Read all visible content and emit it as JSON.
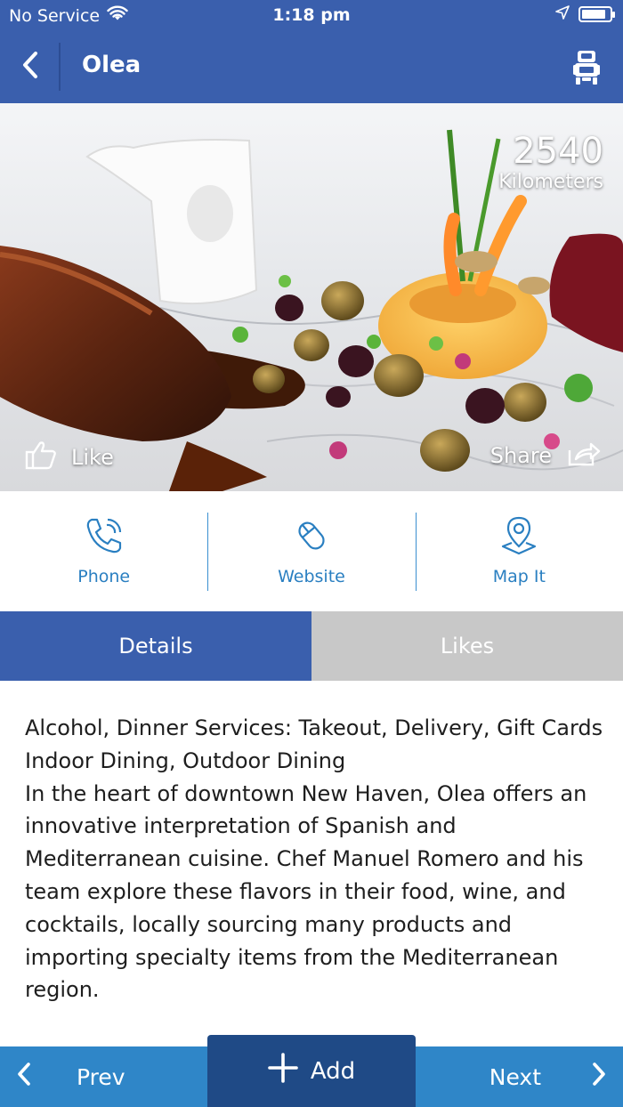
{
  "status_bar": {
    "carrier": "No Service",
    "time": "1:18 pm",
    "battery_level": 0.85,
    "icons": [
      "wifi-icon",
      "location-arrow-icon",
      "battery-icon"
    ]
  },
  "nav": {
    "title": "Olea",
    "back_icon": "chevron-left-icon",
    "action_icon": "passenger-seat-icon"
  },
  "hero": {
    "distance_value": "2540",
    "distance_unit": "Kilometers",
    "like_label": "Like",
    "share_label": "Share"
  },
  "actions": [
    {
      "label": "Phone",
      "icon": "phone-icon"
    },
    {
      "label": "Website",
      "icon": "mouse-icon"
    },
    {
      "label": "Map It",
      "icon": "map-pin-icon"
    }
  ],
  "tabs": [
    {
      "label": "Details",
      "active": true
    },
    {
      "label": "Likes",
      "active": false
    }
  ],
  "details": {
    "line1": "Alcohol, Dinner Services: Takeout, Delivery, Gift Cards",
    "line2": "Indoor Dining, Outdoor Dining",
    "line3": "In the heart of downtown New Haven, Olea offers an innovative interpretation of Spanish and Mediterranean cuisine. Chef Manuel Romero and his team explore these flavors in their food, wine, and cocktails, locally sourcing many products and importing specialty items from the Mediterranean region."
  },
  "bottom_bar": {
    "prev_label": "Prev",
    "add_label": "Add",
    "next_label": "Next"
  },
  "colors": {
    "primary": "#3a5fad",
    "link": "#2a7fc1",
    "bottom_bar": "#2f86c8",
    "add_button": "#1f4a86",
    "tab_inactive": "#c8c8c8"
  }
}
